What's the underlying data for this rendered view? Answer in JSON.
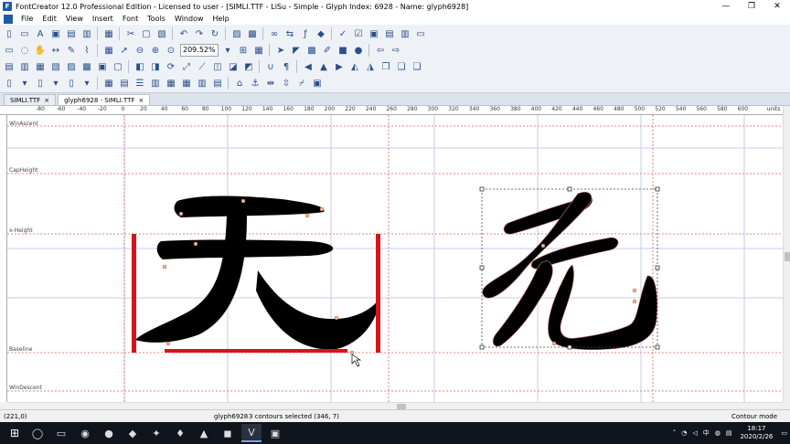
{
  "window": {
    "title": "FontCreator 12.0 Professional Edition - Licensed to user - [SIMLI.TTF - LiSu - Simple - Glyph Index: 6928 - Name: glyph6928]",
    "controls": [
      "—",
      "❐",
      "✕"
    ]
  },
  "menu": [
    "File",
    "Edit",
    "View",
    "Insert",
    "Font",
    "Tools",
    "Window",
    "Help"
  ],
  "toolbar": {
    "zoom_value": "209.52%"
  },
  "tabs": [
    {
      "label": "SIMLI.TTF",
      "close": "×"
    },
    {
      "label": "glyph6928 - SIMLI.TTF",
      "close": "×"
    }
  ],
  "ruler": {
    "ticks": [
      "-80",
      "-60",
      "-40",
      "-20",
      "0",
      "20",
      "40",
      "60",
      "80",
      "100",
      "120",
      "140",
      "160",
      "180",
      "200",
      "220",
      "240",
      "260",
      "280",
      "300",
      "320",
      "340",
      "360",
      "380",
      "400",
      "420",
      "440",
      "460",
      "480",
      "500",
      "520",
      "540",
      "560",
      "580",
      "600"
    ],
    "unit": "units"
  },
  "guides": {
    "win_ascent": "WinAscent",
    "cap_height": "CapHeight",
    "x_height": "x-Height",
    "baseline": "Baseline",
    "win_descent": "WinDescent"
  },
  "status": {
    "coords": "(221,0)",
    "glyph_name": "glyph6928",
    "selection": "3 contours selected (346, 7)",
    "mode": "Contour mode"
  },
  "tray": {
    "time": "18:17",
    "date": "2020/2/26",
    "ime": "中"
  }
}
